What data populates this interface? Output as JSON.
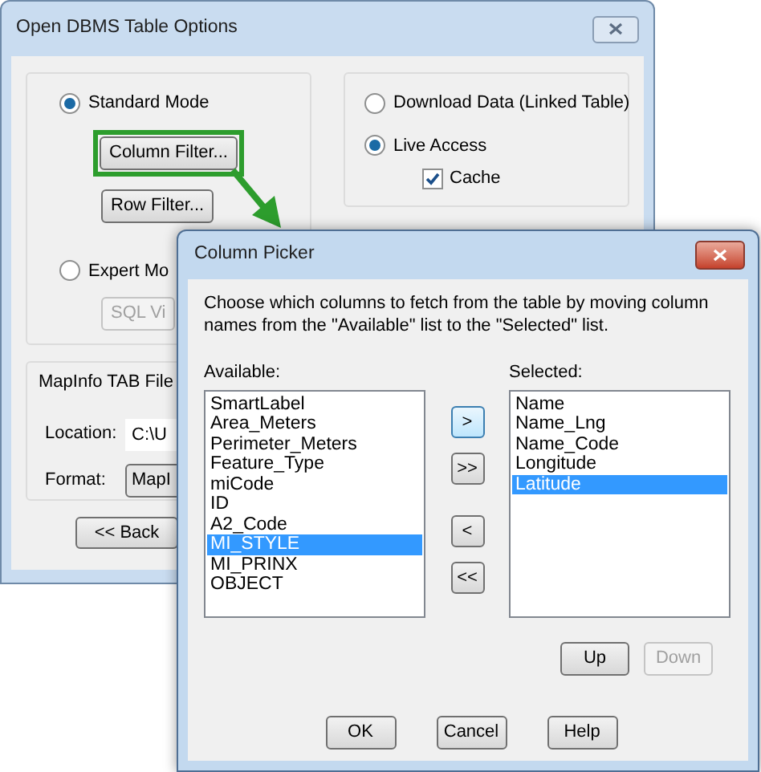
{
  "main_window": {
    "title": "Open DBMS Table Options",
    "modes": [
      {
        "label": "Standard Mode",
        "selected": true,
        "buttons": [
          {
            "label": "Column Filter...",
            "highlighted": true,
            "disabled": false
          },
          {
            "label": "Row Filter...",
            "highlighted": false,
            "disabled": false
          }
        ]
      },
      {
        "label": "Expert Mo",
        "selected": false,
        "buttons": [
          {
            "label": "SQL Vi",
            "highlighted": false,
            "disabled": true
          }
        ]
      }
    ],
    "access": [
      {
        "label": "Download Data (Linked Table)",
        "selected": false
      },
      {
        "label": "Live Access",
        "selected": true
      }
    ],
    "cache": {
      "label": "Cache",
      "checked": true
    },
    "tab_file": {
      "title": "MapInfo TAB File",
      "location_label": "Location:",
      "location_value": "C:\\U",
      "format_label": "Format:",
      "format_value": "MapI"
    },
    "back_button": "<< Back"
  },
  "column_picker": {
    "title": "Column Picker",
    "description": "Choose which columns to fetch from the table by moving column names from the \"Available\" list to the \"Selected\" list.",
    "available_label": "Available:",
    "available": [
      {
        "label": "SmartLabel",
        "selected": false
      },
      {
        "label": "Area_Meters",
        "selected": false
      },
      {
        "label": "Perimeter_Meters",
        "selected": false
      },
      {
        "label": "Feature_Type",
        "selected": false
      },
      {
        "label": "miCode",
        "selected": false
      },
      {
        "label": "ID",
        "selected": false
      },
      {
        "label": "A2_Code",
        "selected": false
      },
      {
        "label": "MI_STYLE",
        "selected": true
      },
      {
        "label": "MI_PRINX",
        "selected": false
      },
      {
        "label": "OBJECT",
        "selected": false
      }
    ],
    "selected_label": "Selected:",
    "selected": [
      {
        "label": "Name",
        "selected": false
      },
      {
        "label": "Name_Lng",
        "selected": false
      },
      {
        "label": "Name_Code",
        "selected": false
      },
      {
        "label": "Longitude",
        "selected": false
      },
      {
        "label": "Latitude",
        "selected": true
      }
    ],
    "move_buttons": [
      {
        "label": ">",
        "focused": true
      },
      {
        "label": ">>",
        "focused": false
      },
      {
        "label": "<",
        "focused": false
      },
      {
        "label": "<<",
        "focused": false
      }
    ],
    "order_buttons": [
      {
        "label": "Up",
        "disabled": false
      },
      {
        "label": "Down",
        "disabled": true
      }
    ],
    "footer_buttons": [
      "OK",
      "Cancel",
      "Help"
    ]
  }
}
